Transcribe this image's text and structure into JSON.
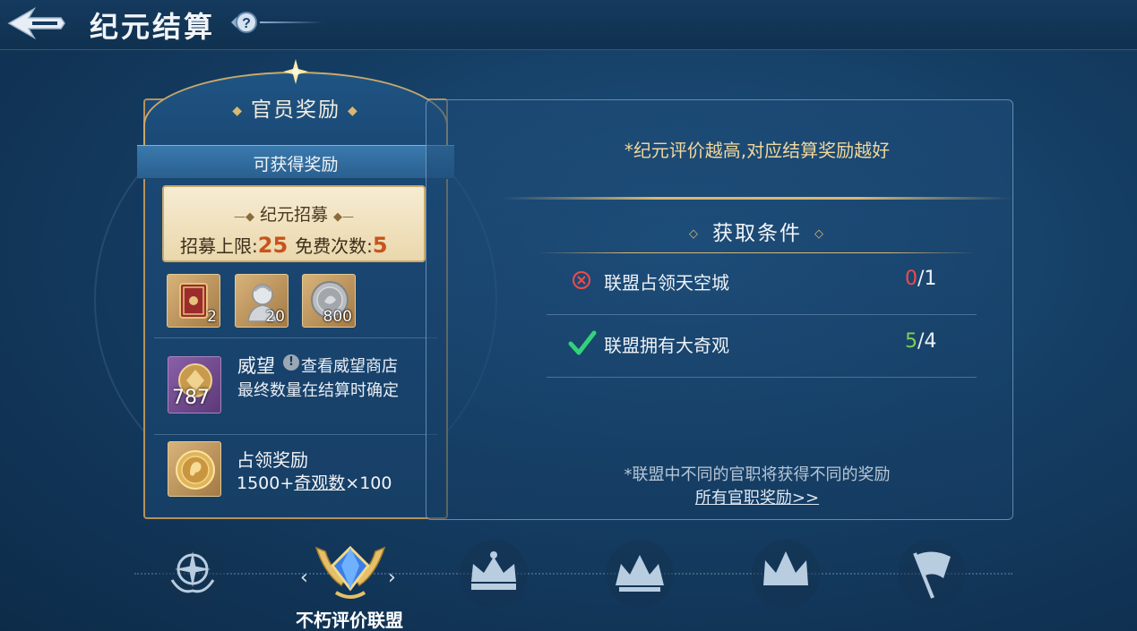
{
  "header": {
    "title": "纪元结算",
    "help_icon": "?"
  },
  "left_card": {
    "title": "官员奖励",
    "ribbon": "可获得奖励",
    "recruit": {
      "title": "纪元招募",
      "limit_label": "招募上限:",
      "limit_value": "25",
      "free_label": "免费次数:",
      "free_value": "5"
    },
    "items": [
      {
        "icon": "book-icon",
        "count": "2"
      },
      {
        "icon": "statue-icon",
        "count": "20"
      },
      {
        "icon": "coin-icon",
        "count": "800"
      }
    ],
    "prestige": {
      "name": "威望",
      "alert": "!",
      "link": "查看威望商店",
      "desc": "最终数量在结算时确定",
      "count": "787"
    },
    "occupy": {
      "title": "占领奖励",
      "base": "1500+",
      "wonder": "奇观数",
      "mult": "×100"
    }
  },
  "right_panel": {
    "tip": "*纪元评价越高,对应结算奖励越好",
    "conditions_title": "获取条件",
    "conditions": [
      {
        "status": "fail",
        "label": "联盟占领天空城",
        "current": "0",
        "total": "/1"
      },
      {
        "status": "pass",
        "label": "联盟拥有大奇观",
        "current": "5",
        "total": "/4"
      }
    ],
    "note": "*联盟中不同的官职将获得不同的奖励",
    "link": "所有官职奖励>>"
  },
  "tiers": {
    "selected_name": "不朽评价联盟",
    "prev": "‹",
    "next": "›"
  },
  "colors": {
    "fail": "#ef4b4b",
    "pass": "#7dcf4d",
    "gold": "#d9b873",
    "highlight": "#c7541d"
  }
}
